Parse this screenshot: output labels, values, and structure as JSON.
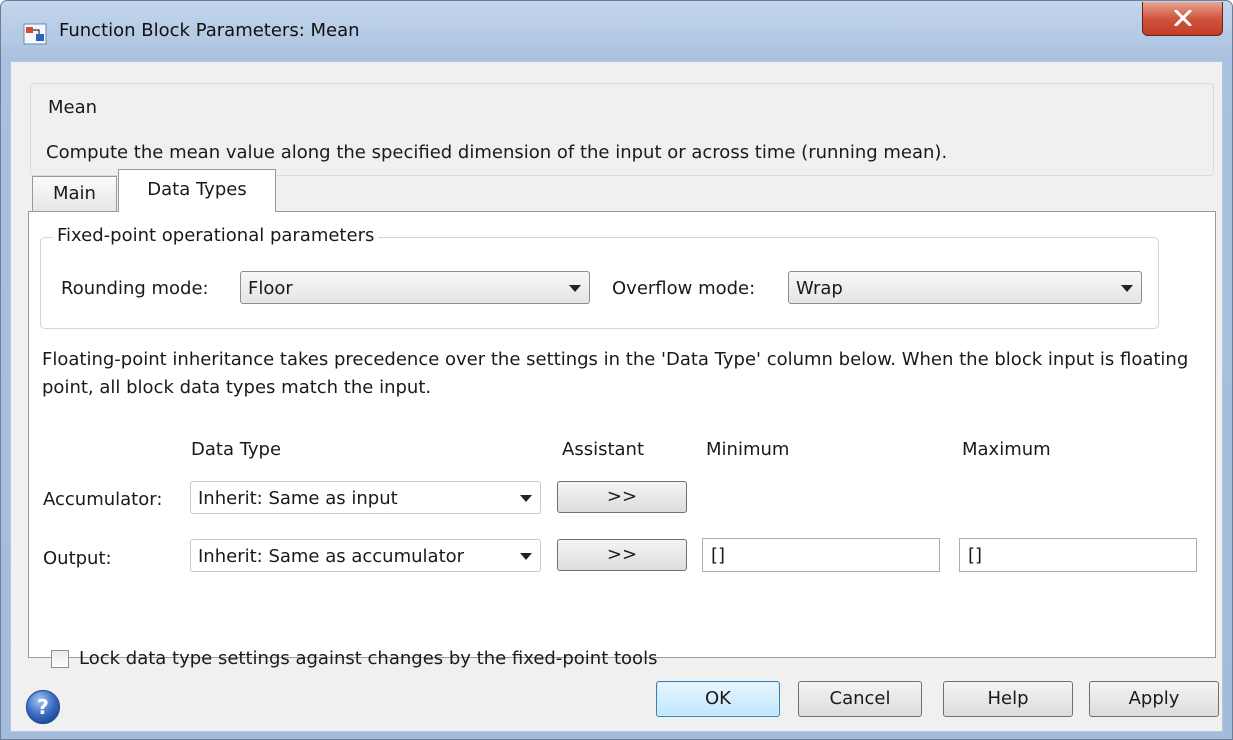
{
  "window": {
    "title": "Function Block Parameters: Mean"
  },
  "description": {
    "group_title": "Mean",
    "text": "Compute the mean value along the specified dimension of the input or across time (running mean)."
  },
  "tabs": [
    {
      "label": "Main",
      "selected": false
    },
    {
      "label": "Data Types",
      "selected": true
    }
  ],
  "fixed_point": {
    "group_title": "Fixed-point operational parameters",
    "rounding_label": "Rounding mode:",
    "rounding_value": "Floor",
    "overflow_label": "Overflow mode:",
    "overflow_value": "Wrap"
  },
  "info_text": "Floating-point inheritance takes precedence over the settings in the 'Data Type' column below. When the block input is floating point, all block data types match the input.",
  "table": {
    "headers": {
      "data_type": "Data Type",
      "assistant": "Assistant",
      "minimum": "Minimum",
      "maximum": "Maximum"
    },
    "rows": [
      {
        "label": "Accumulator:",
        "data_type": "Inherit: Same as input",
        "assistant": ">>"
      },
      {
        "label": "Output:",
        "data_type": "Inherit: Same as accumulator",
        "assistant": ">>",
        "minimum": "[]",
        "maximum": "[]"
      }
    ]
  },
  "lock_checkbox": {
    "label": "Lock data type settings against changes by the fixed-point tools",
    "checked": false
  },
  "buttons": {
    "ok": "OK",
    "cancel": "Cancel",
    "help": "Help",
    "apply": "Apply"
  },
  "colors": {
    "titlebar": "#a9c1df",
    "close_button": "#c9472f",
    "ok_button": "#bee6fd",
    "dialog_bg": "#f0f0f0"
  },
  "icons": {
    "app": "simulink-app-icon",
    "close": "close-icon",
    "help": "help-icon",
    "dropdown": "chevron-down-icon"
  }
}
